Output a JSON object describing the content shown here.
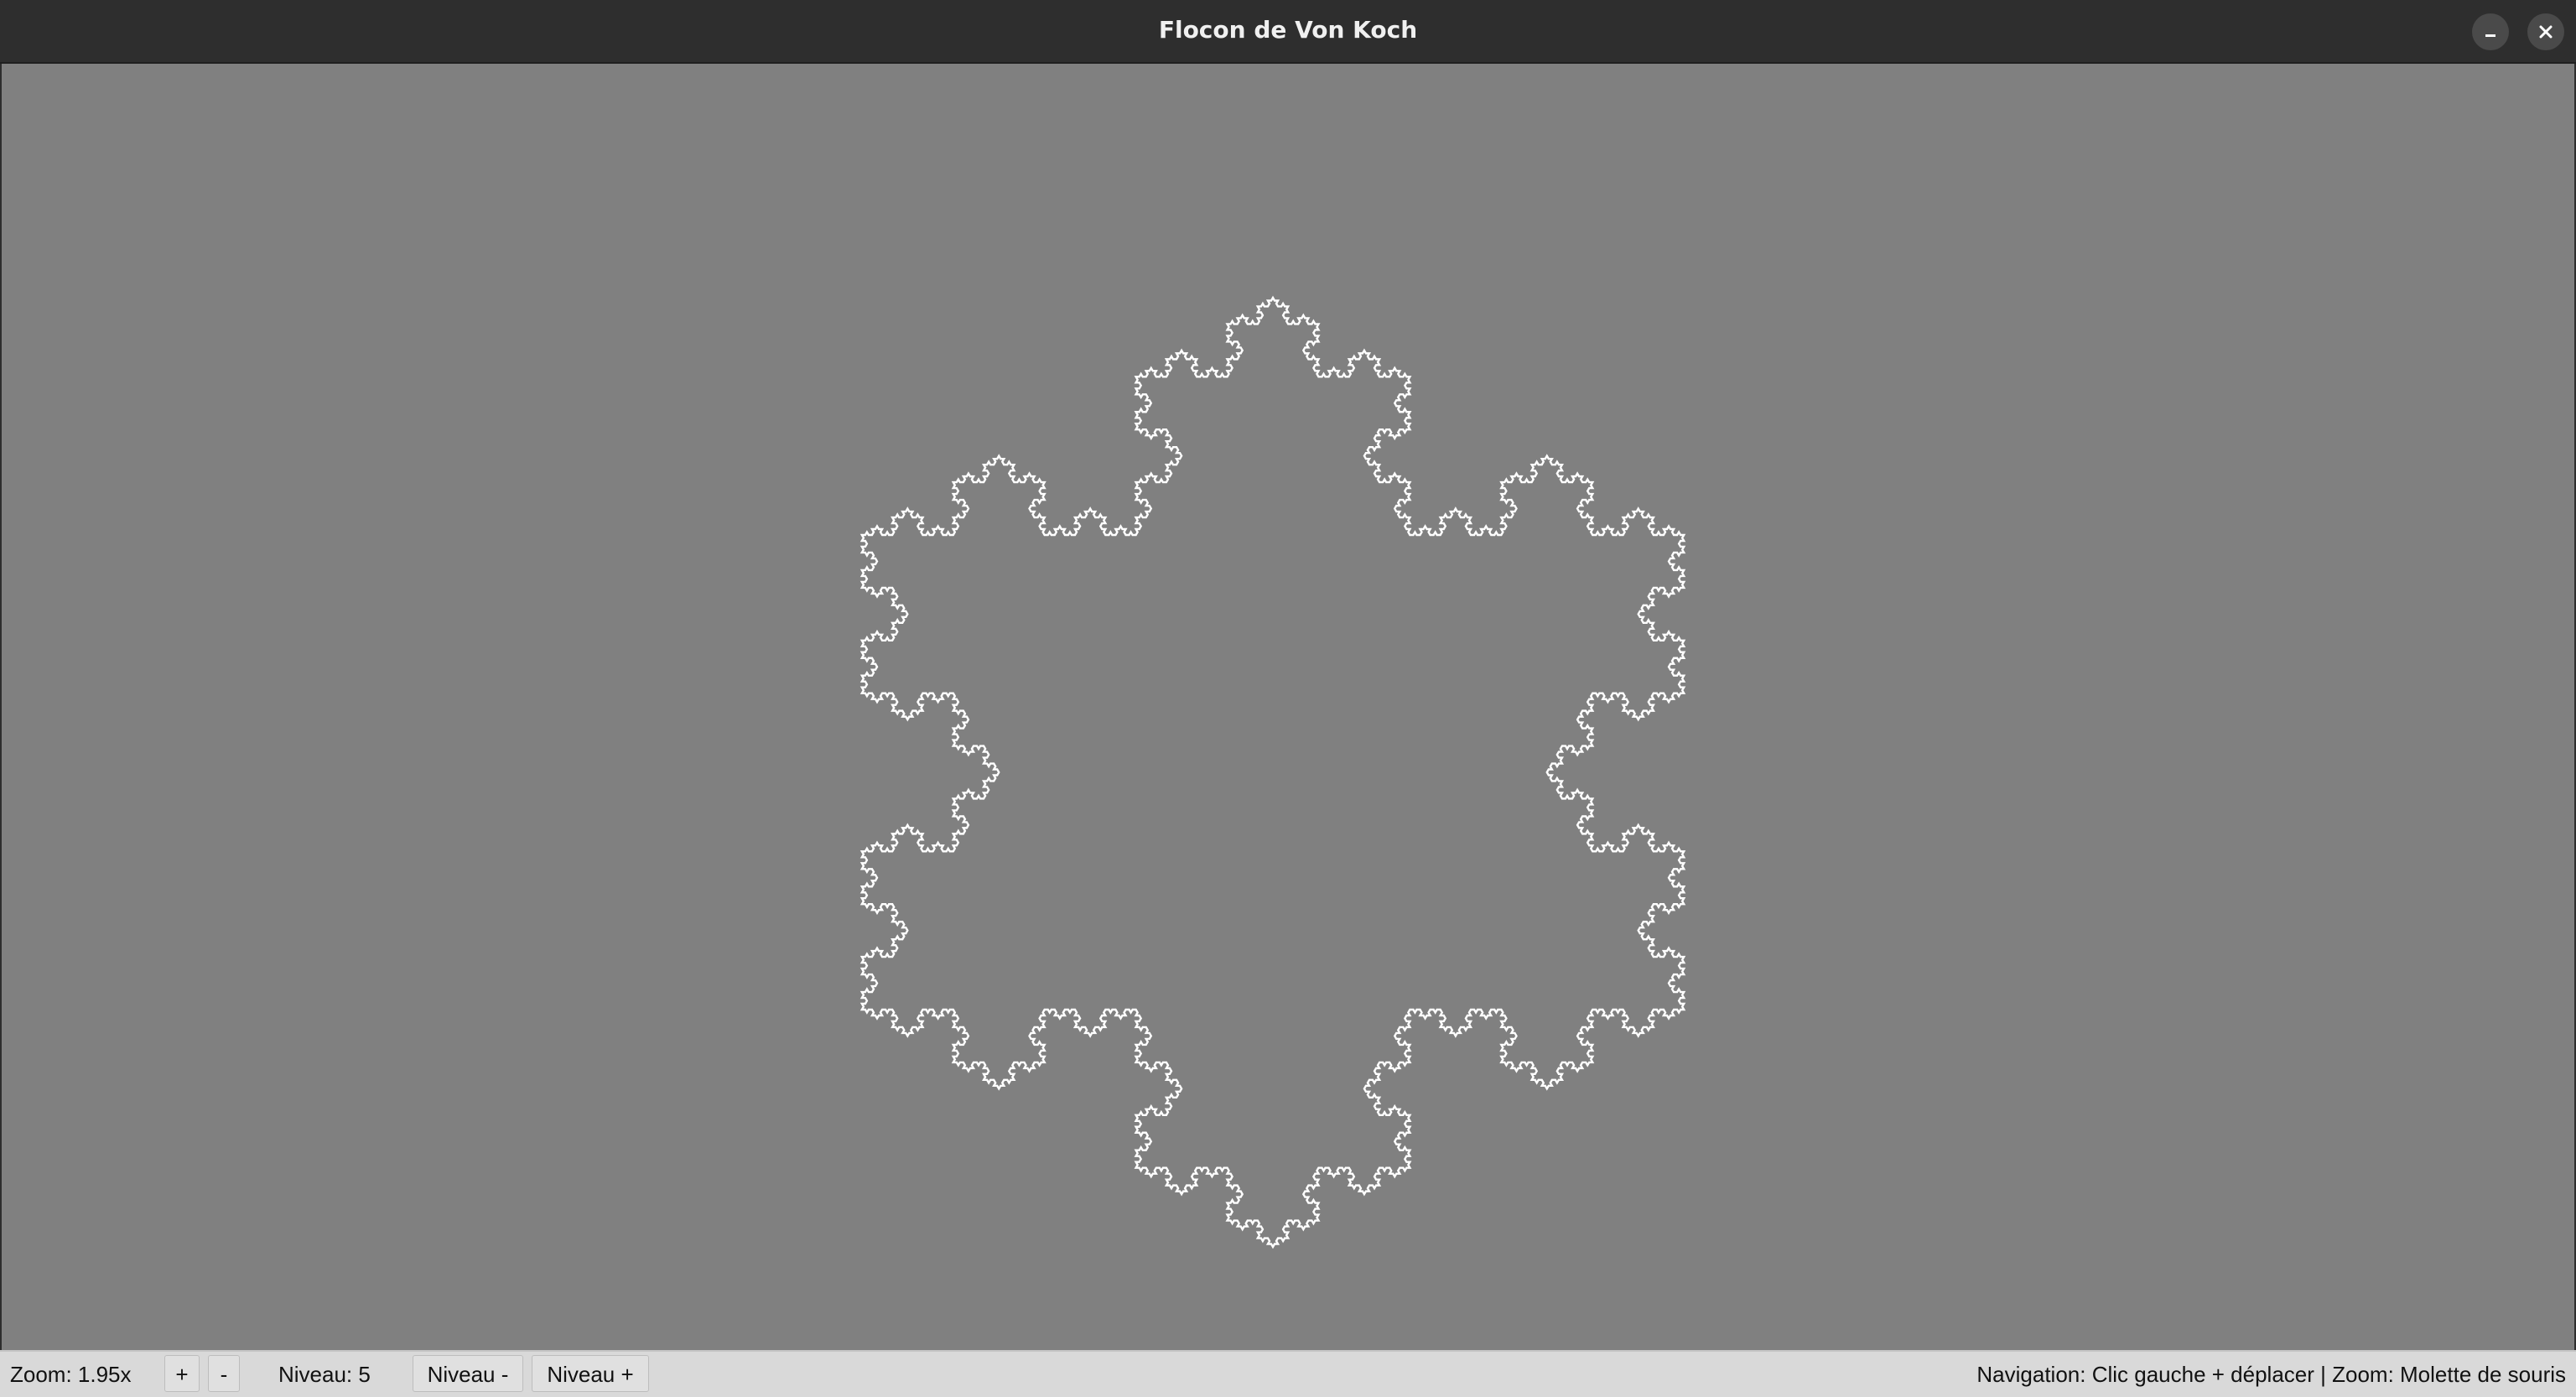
{
  "window": {
    "title": "Flocon de Von Koch",
    "minimize_icon": "minimize-icon",
    "close_icon": "close-icon"
  },
  "canvas": {
    "background_color": "#808080",
    "stroke_color": "#ffffff",
    "fractal": "koch-snowflake",
    "level": 5
  },
  "toolbar": {
    "zoom_label": "Zoom: 1.95x",
    "zoom_in": "+",
    "zoom_out": "-",
    "level_label": "Niveau: 5",
    "level_down": "Niveau -",
    "level_up": "Niveau +",
    "help_text": "Navigation: Clic gauche + déplacer | Zoom: Molette de souris"
  }
}
